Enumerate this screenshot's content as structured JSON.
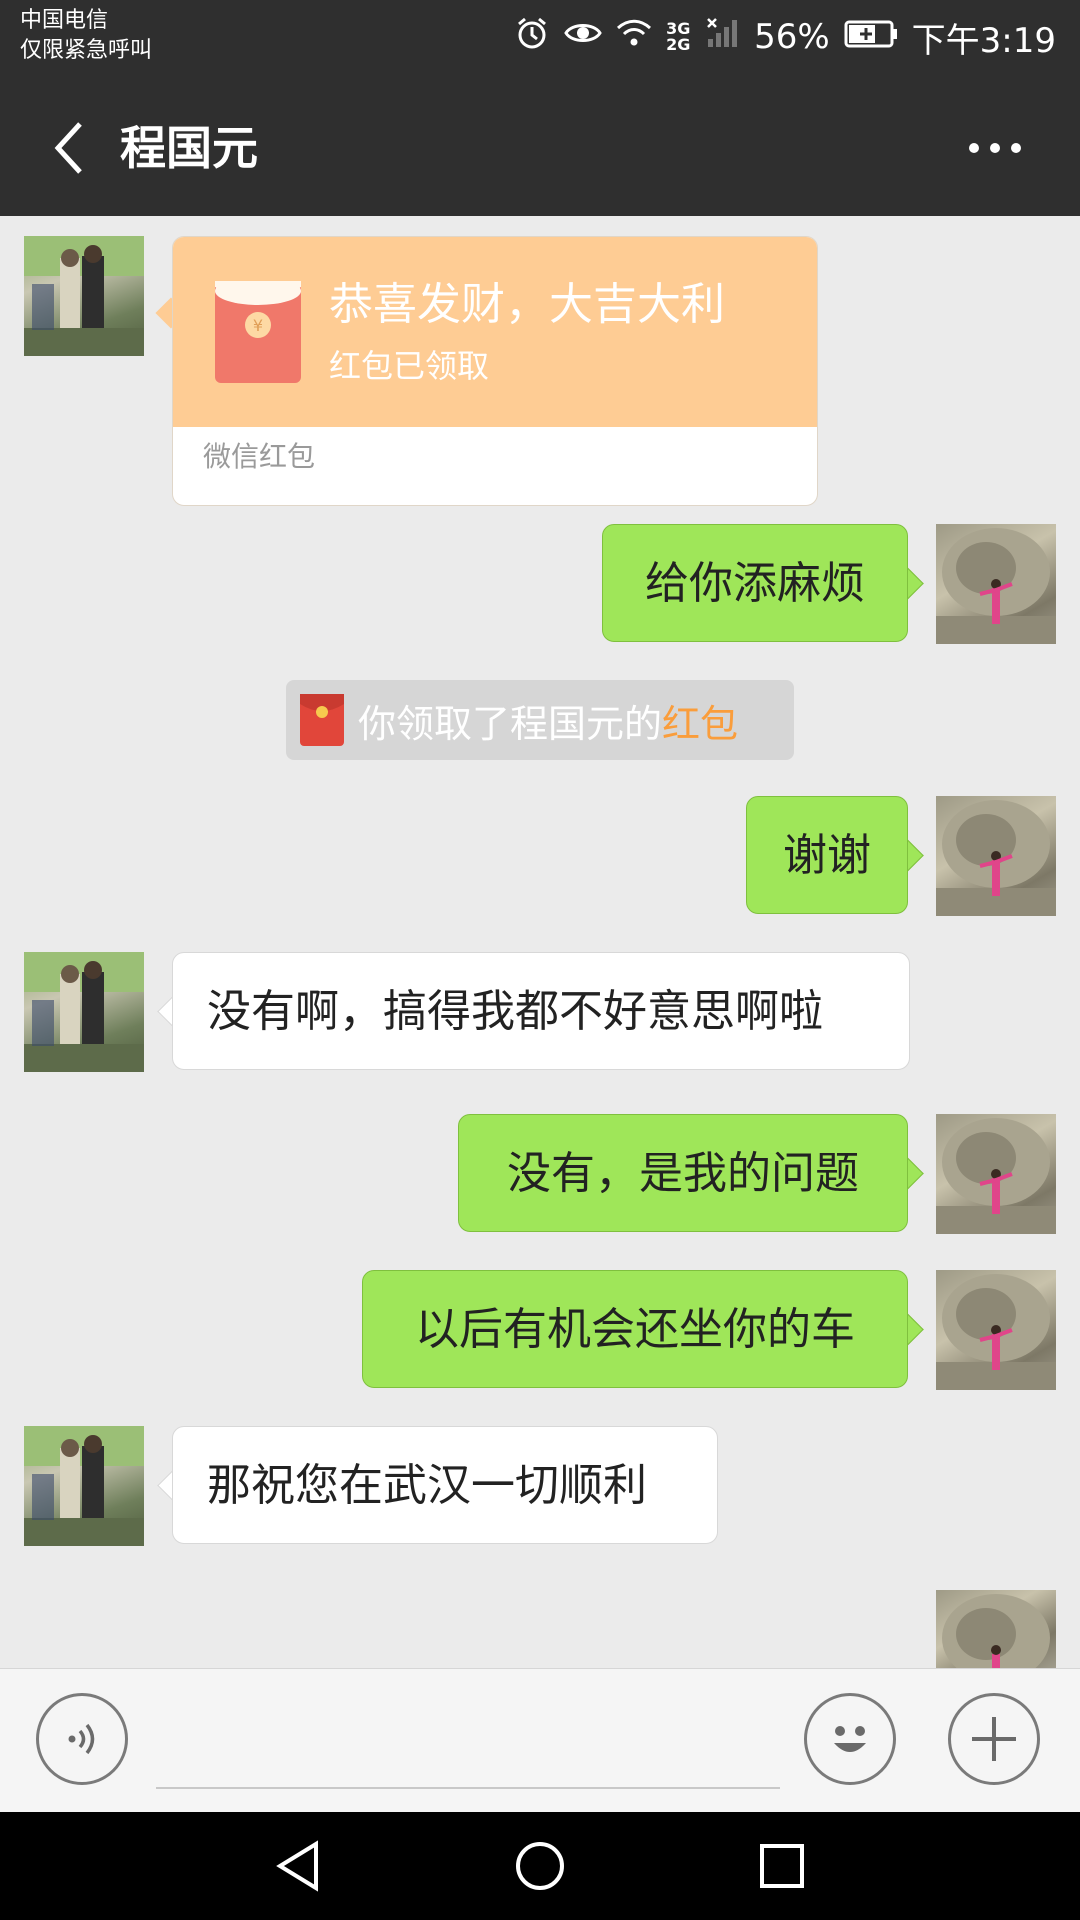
{
  "status_bar": {
    "carrier": "中国电信",
    "carrier_note": "仅限紧急呼叫",
    "network": "3G 2G",
    "battery": "56%",
    "time": "下午3:19",
    "icons": [
      "alarm-icon",
      "eye-icon",
      "wifi-icon",
      "signal-icon",
      "no-signal-icon",
      "battery-charging-icon"
    ]
  },
  "nav": {
    "title": "程国元",
    "back_icon": "back-arrow-icon",
    "more_icon": "more-dots-icon"
  },
  "messages": [
    {
      "type": "red_packet",
      "from": "other",
      "title": "恭喜发财，大吉大利",
      "status": "红包已领取",
      "source": "微信红包"
    },
    {
      "type": "text",
      "from": "self",
      "text": "给你添麻烦"
    },
    {
      "type": "system",
      "text": "你领取了程国元的",
      "link": "红包"
    },
    {
      "type": "text",
      "from": "self",
      "text": "谢谢"
    },
    {
      "type": "text",
      "from": "other",
      "text": "没有啊，搞得我都不好意思啊啦"
    },
    {
      "type": "text",
      "from": "self",
      "text": "没有，是我的问题"
    },
    {
      "type": "text",
      "from": "self",
      "text": "以后有机会还坐你的车"
    },
    {
      "type": "text",
      "from": "other",
      "text": "那祝您在武汉一切顺利"
    }
  ],
  "input_bar": {
    "voice_icon": "voice-icon",
    "emoji_icon": "emoji-icon",
    "plus_icon": "plus-icon",
    "input_value": ""
  },
  "system_nav": [
    "back-triangle-icon",
    "home-circle-icon",
    "recents-square-icon"
  ],
  "colors": {
    "header_bg": "#2f2f2f",
    "chat_bg": "#ebebeb",
    "self_bubble": "#9fe659",
    "other_bubble": "#ffffff",
    "red_packet": "#fecc94",
    "link": "#fa9d3b"
  }
}
